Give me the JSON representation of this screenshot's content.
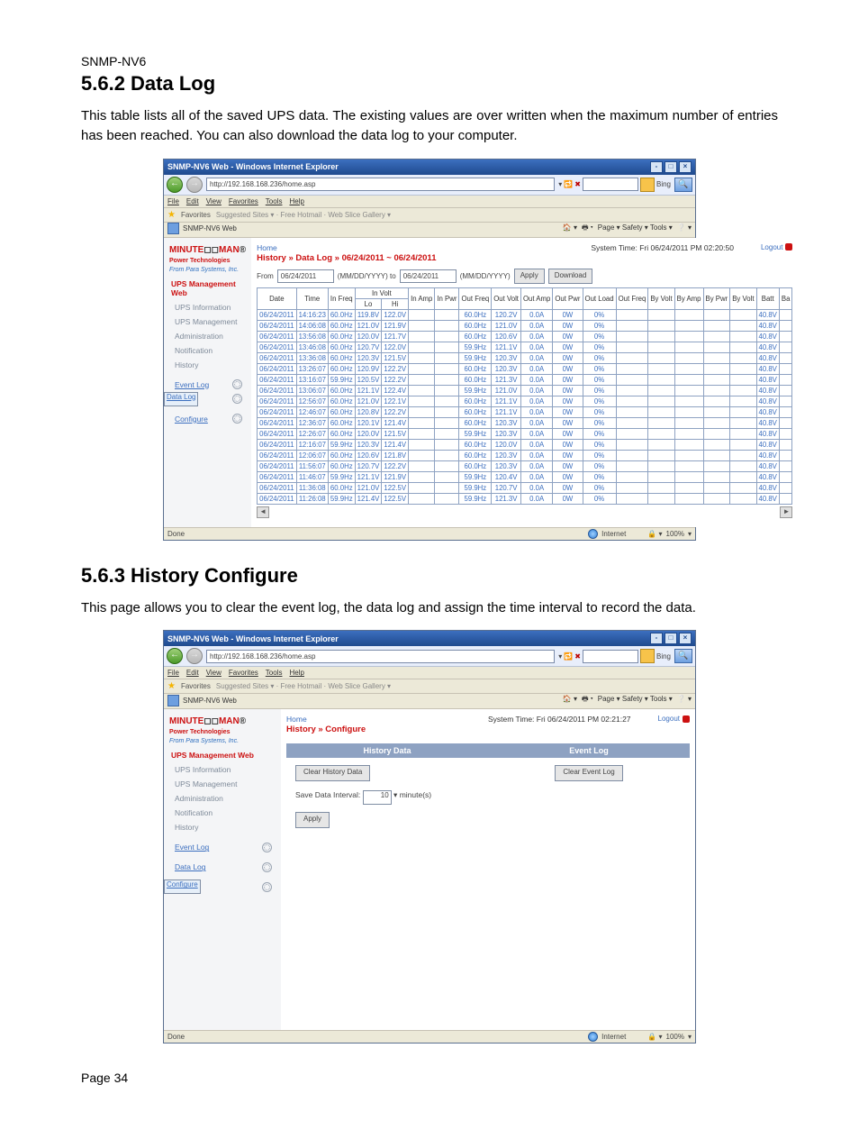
{
  "doc": {
    "product": "SNMP-NV6",
    "section1_num_title": "5.6.2 Data Log",
    "section1_body": "This table lists all of the saved UPS data. The existing values are over written when the maximum number of entries has been reached. You can also download the data log to your computer.",
    "section2_num_title": "5.6.3 History Configure",
    "section2_body": "This page allows you to clear the event log, the data log and assign the time interval to record the data.",
    "page_footer": "Page 34"
  },
  "browser": {
    "title": "SNMP-NV6 Web - Windows Internet Explorer",
    "url": "http://192.168.168.236/home.asp",
    "search_provider": "Bing",
    "menus": [
      "File",
      "Edit",
      "View",
      "Favorites",
      "Tools",
      "Help"
    ],
    "fav_label": "Favorites",
    "fav_links": "Suggested Sites ▾  ·  Free Hotmail  ·  Web Slice Gallery ▾",
    "tab_label": "SNMP-NV6 Web",
    "toolbar_text": "Page ▾  Safety ▾  Tools ▾",
    "status_done": "Done",
    "status_zone": "Internet",
    "status_zoom": "100%"
  },
  "brand": {
    "line1a": "MINUTE",
    "line1b": "MAN",
    "sub1": "Power Technologies",
    "sub2": "From Para Systems, Inc."
  },
  "nav": {
    "header": "UPS Management Web",
    "items": [
      "UPS Information",
      "UPS Management",
      "Administration",
      "Notification",
      "History"
    ],
    "hist_items": [
      {
        "label": "Event Log",
        "sel": false
      },
      {
        "label": "Data Log",
        "sel": true
      },
      {
        "label": "Configure",
        "sel": false
      }
    ],
    "hist_items_b": [
      {
        "label": "Event Log",
        "sel": false
      },
      {
        "label": "Data Log",
        "sel": false
      },
      {
        "label": "Configure",
        "sel": true
      }
    ]
  },
  "screen1": {
    "home": "Home",
    "crumb": "History » Data Log » 06/24/2011 ~ 06/24/2011",
    "systime": "System Time: Fri 06/24/2011 PM 02:20:50",
    "logout": "Logout",
    "from": "From",
    "from_v": "06/24/2011",
    "hint1": "(MM/DD/YYYY) to",
    "to_v": "06/24/2011",
    "hint2": "(MM/DD/YYYY)",
    "apply": "Apply",
    "download": "Download",
    "headers_top": [
      "Date",
      "Time",
      "In Freq",
      "In Volt",
      "",
      "In Amp",
      "In Pwr",
      "Out Freq",
      "Out Volt",
      "Out Amp",
      "Out Pwr",
      "Out Load",
      "Out Freq",
      "By Volt",
      "By Amp",
      "By Pwr",
      "By Volt",
      "Batt",
      "Ba"
    ],
    "sub_lo": "Lo",
    "sub_hi": "Hi",
    "chart_data": {
      "type": "table",
      "columns": [
        "Date",
        "Time",
        "In Freq",
        "In Volt Lo",
        "In Volt Hi",
        "In Amp",
        "In Pwr",
        "Out Freq",
        "Out Volt",
        "Out Amp",
        "Out Pwr",
        "Out Load",
        "Out Freq 2",
        "By Volt",
        "By Amp",
        "By Pwr",
        "By Volt 2",
        "Batt"
      ],
      "rows": [
        [
          "06/24/2011",
          "14:16:23",
          "60.0Hz",
          "119.8V",
          "122.0V",
          "",
          "",
          "60.0Hz",
          "120.2V",
          "0.0A",
          "0W",
          "0%",
          "",
          "",
          "",
          "",
          "",
          "40.8V"
        ],
        [
          "06/24/2011",
          "14:06:08",
          "60.0Hz",
          "121.0V",
          "121.9V",
          "",
          "",
          "60.0Hz",
          "121.0V",
          "0.0A",
          "0W",
          "0%",
          "",
          "",
          "",
          "",
          "",
          "40.8V"
        ],
        [
          "06/24/2011",
          "13:56:08",
          "60.0Hz",
          "120.0V",
          "121.7V",
          "",
          "",
          "60.0Hz",
          "120.6V",
          "0.0A",
          "0W",
          "0%",
          "",
          "",
          "",
          "",
          "",
          "40.8V"
        ],
        [
          "06/24/2011",
          "13:46:08",
          "60.0Hz",
          "120.7V",
          "122.0V",
          "",
          "",
          "59.9Hz",
          "121.1V",
          "0.0A",
          "0W",
          "0%",
          "",
          "",
          "",
          "",
          "",
          "40.8V"
        ],
        [
          "06/24/2011",
          "13:36:08",
          "60.0Hz",
          "120.3V",
          "121.5V",
          "",
          "",
          "59.9Hz",
          "120.3V",
          "0.0A",
          "0W",
          "0%",
          "",
          "",
          "",
          "",
          "",
          "40.8V"
        ],
        [
          "06/24/2011",
          "13:26:07",
          "60.0Hz",
          "120.9V",
          "122.2V",
          "",
          "",
          "60.0Hz",
          "120.3V",
          "0.0A",
          "0W",
          "0%",
          "",
          "",
          "",
          "",
          "",
          "40.8V"
        ],
        [
          "06/24/2011",
          "13:16:07",
          "59.9Hz",
          "120.5V",
          "122.2V",
          "",
          "",
          "60.0Hz",
          "121.3V",
          "0.0A",
          "0W",
          "0%",
          "",
          "",
          "",
          "",
          "",
          "40.8V"
        ],
        [
          "06/24/2011",
          "13:06:07",
          "60.0Hz",
          "121.1V",
          "122.4V",
          "",
          "",
          "59.9Hz",
          "121.0V",
          "0.0A",
          "0W",
          "0%",
          "",
          "",
          "",
          "",
          "",
          "40.8V"
        ],
        [
          "06/24/2011",
          "12:56:07",
          "60.0Hz",
          "121.0V",
          "122.1V",
          "",
          "",
          "60.0Hz",
          "121.1V",
          "0.0A",
          "0W",
          "0%",
          "",
          "",
          "",
          "",
          "",
          "40.8V"
        ],
        [
          "06/24/2011",
          "12:46:07",
          "60.0Hz",
          "120.8V",
          "122.2V",
          "",
          "",
          "60.0Hz",
          "121.1V",
          "0.0A",
          "0W",
          "0%",
          "",
          "",
          "",
          "",
          "",
          "40.8V"
        ],
        [
          "06/24/2011",
          "12:36:07",
          "60.0Hz",
          "120.1V",
          "121.4V",
          "",
          "",
          "60.0Hz",
          "120.3V",
          "0.0A",
          "0W",
          "0%",
          "",
          "",
          "",
          "",
          "",
          "40.8V"
        ],
        [
          "06/24/2011",
          "12:26:07",
          "60.0Hz",
          "120.0V",
          "121.5V",
          "",
          "",
          "59.9Hz",
          "120.3V",
          "0.0A",
          "0W",
          "0%",
          "",
          "",
          "",
          "",
          "",
          "40.8V"
        ],
        [
          "06/24/2011",
          "12:16:07",
          "59.9Hz",
          "120.3V",
          "121.4V",
          "",
          "",
          "60.0Hz",
          "120.0V",
          "0.0A",
          "0W",
          "0%",
          "",
          "",
          "",
          "",
          "",
          "40.8V"
        ],
        [
          "06/24/2011",
          "12:06:07",
          "60.0Hz",
          "120.6V",
          "121.8V",
          "",
          "",
          "60.0Hz",
          "120.3V",
          "0.0A",
          "0W",
          "0%",
          "",
          "",
          "",
          "",
          "",
          "40.8V"
        ],
        [
          "06/24/2011",
          "11:56:07",
          "60.0Hz",
          "120.7V",
          "122.2V",
          "",
          "",
          "60.0Hz",
          "120.3V",
          "0.0A",
          "0W",
          "0%",
          "",
          "",
          "",
          "",
          "",
          "40.8V"
        ],
        [
          "06/24/2011",
          "11:46:07",
          "59.9Hz",
          "121.1V",
          "121.9V",
          "",
          "",
          "59.9Hz",
          "120.4V",
          "0.0A",
          "0W",
          "0%",
          "",
          "",
          "",
          "",
          "",
          "40.8V"
        ],
        [
          "06/24/2011",
          "11:36:08",
          "60.0Hz",
          "121.0V",
          "122.5V",
          "",
          "",
          "59.9Hz",
          "120.7V",
          "0.0A",
          "0W",
          "0%",
          "",
          "",
          "",
          "",
          "",
          "40.8V"
        ],
        [
          "06/24/2011",
          "11:26:08",
          "59.9Hz",
          "121.4V",
          "122.5V",
          "",
          "",
          "59.9Hz",
          "121.3V",
          "0.0A",
          "0W",
          "0%",
          "",
          "",
          "",
          "",
          "",
          "40.8V"
        ]
      ]
    }
  },
  "screen2": {
    "home": "Home",
    "crumb": "History » Configure",
    "systime": "System Time: Fri 06/24/2011 PM 02:21:27",
    "logout": "Logout",
    "col1": "History Data",
    "col2": "Event Log",
    "clear_hist": "Clear History Data",
    "clear_evt": "Clear Event Log",
    "interval_label": "Save Data Interval:",
    "interval_v": "10",
    "interval_unit": "minute(s)",
    "apply": "Apply"
  }
}
